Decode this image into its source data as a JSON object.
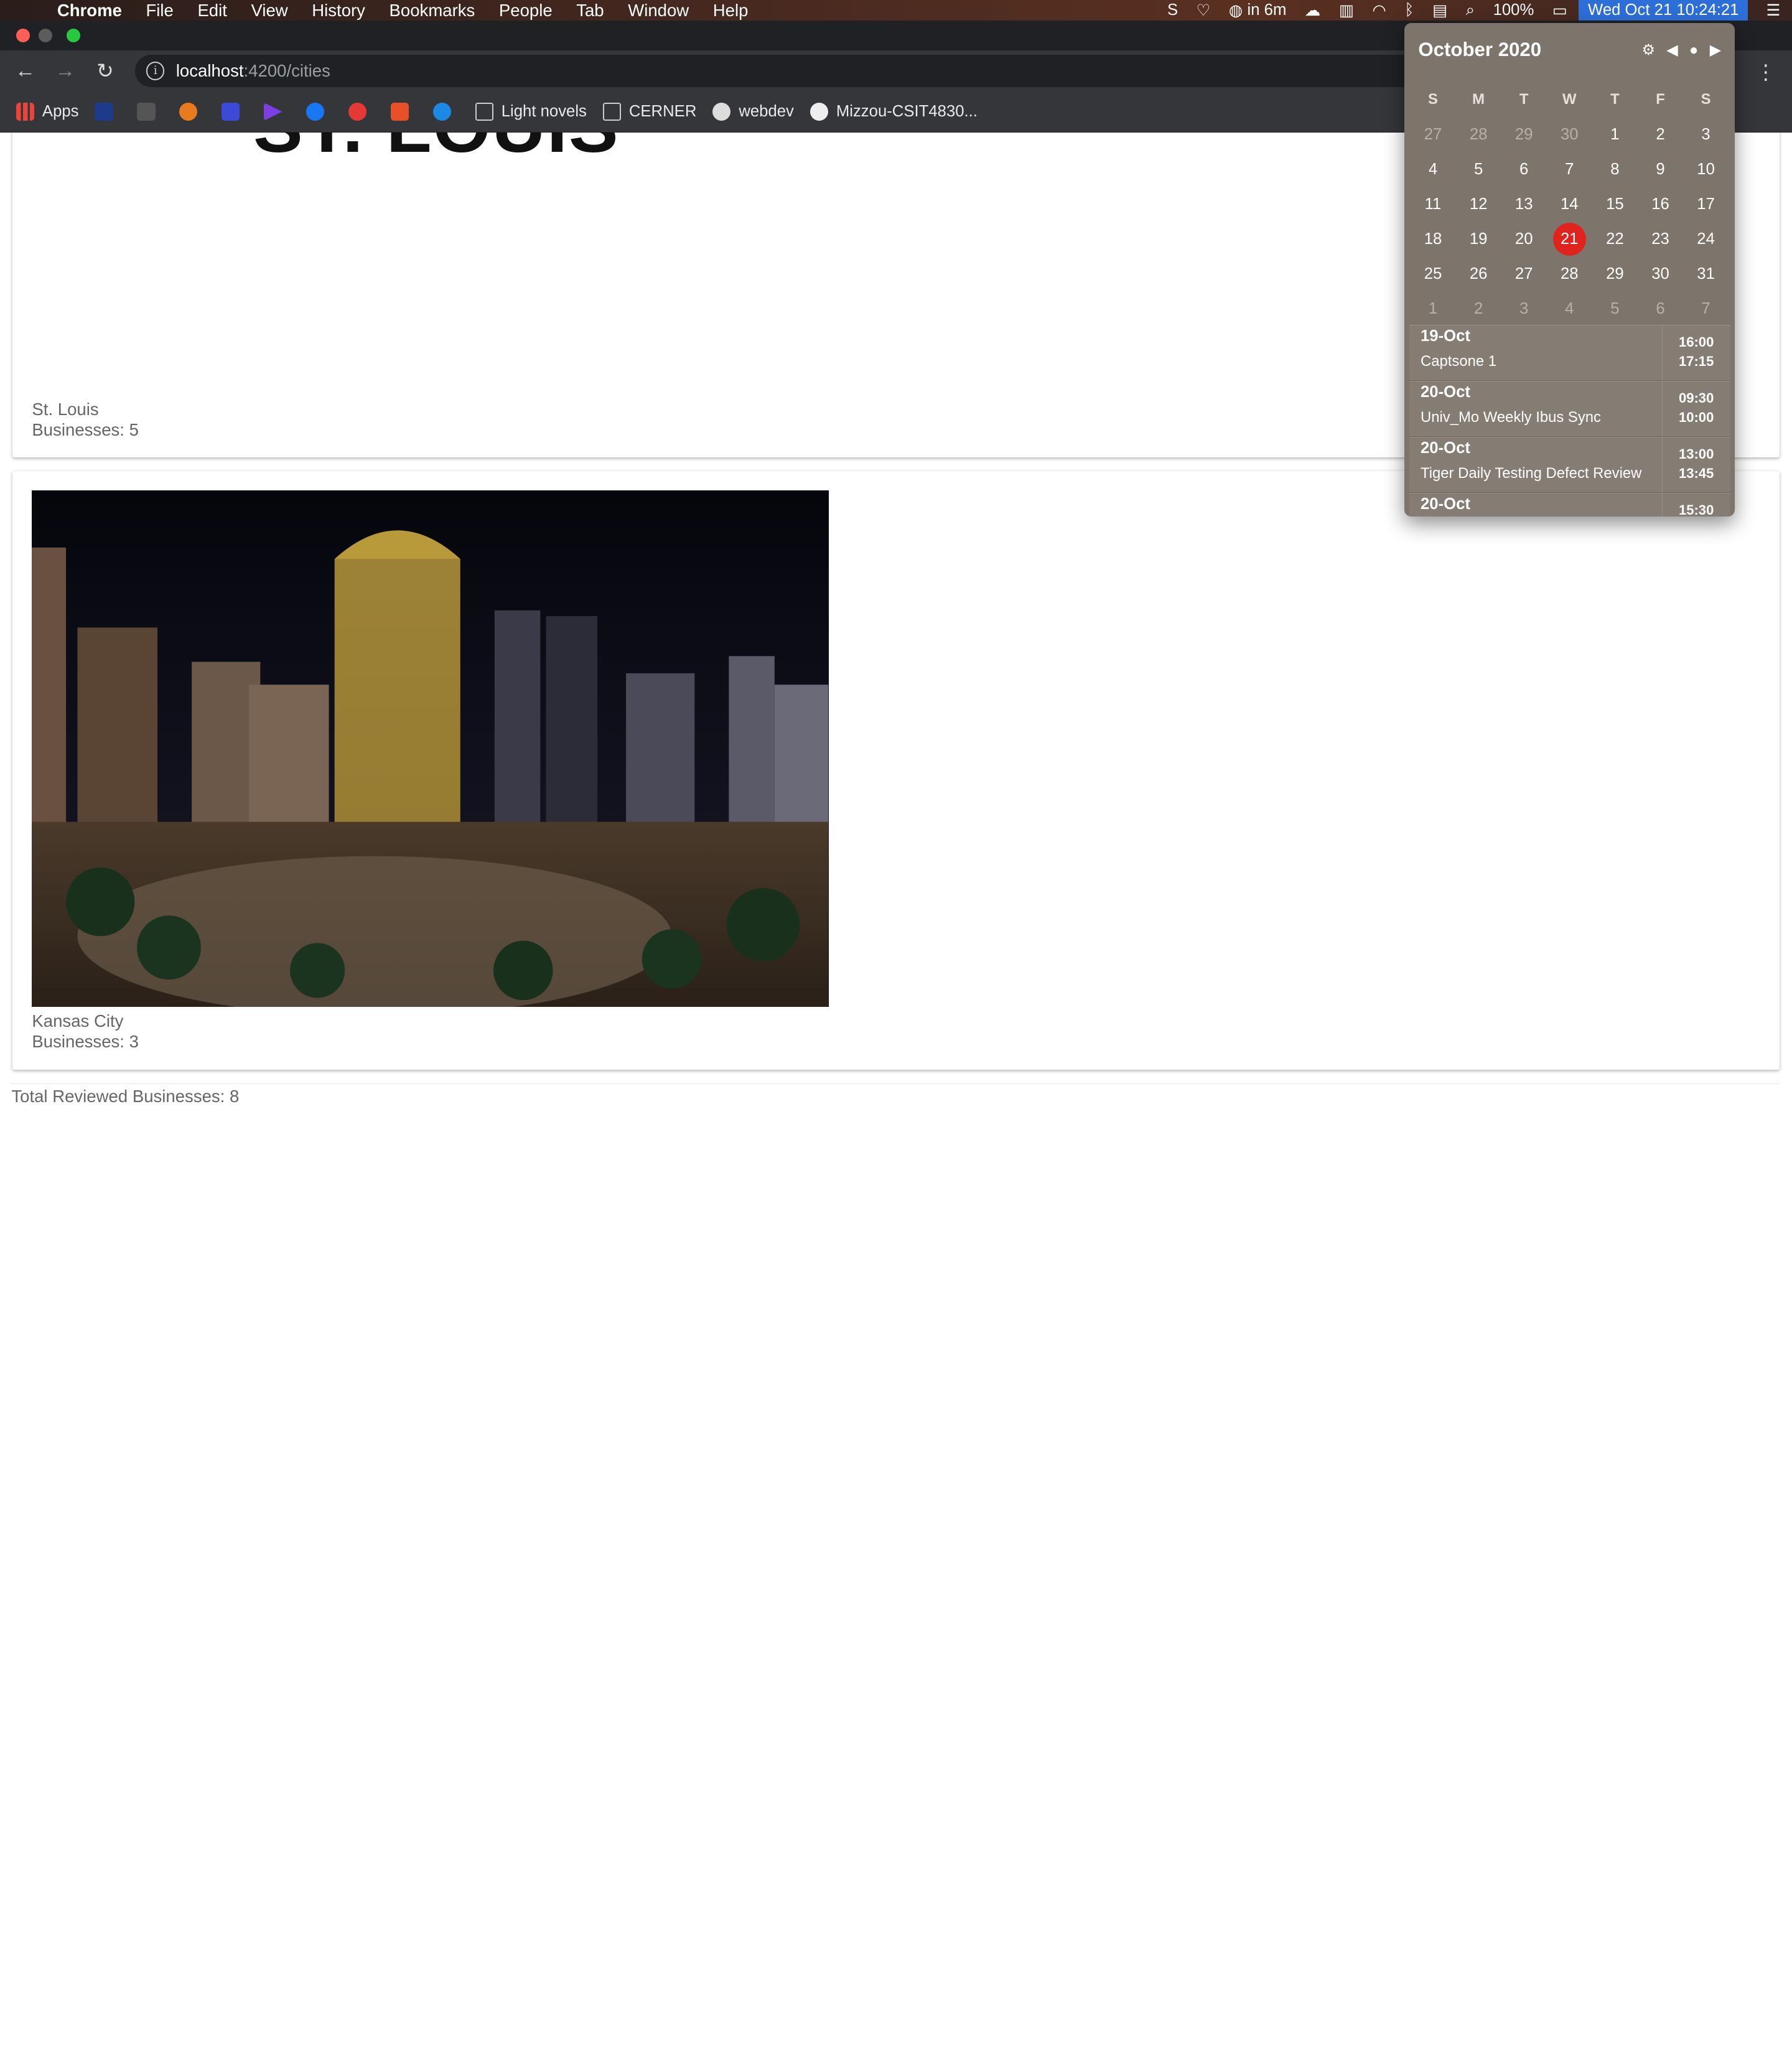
{
  "menubar": {
    "app": "Chrome",
    "items": [
      "File",
      "Edit",
      "View",
      "History",
      "Bookmarks",
      "People",
      "Tab",
      "Window",
      "Help"
    ],
    "status": {
      "meeting": "in 6m",
      "battery": "100%",
      "clock": "Wed Oct 21  10:24:21"
    }
  },
  "browser": {
    "url_host": "localhost",
    "url_path": ":4200/cities",
    "bookmarks": [
      "Apps",
      "Light novels",
      "CERNER",
      "webdev",
      "Mizzou-CSIT4830..."
    ]
  },
  "cities": [
    {
      "logo_text": "ST. LOUIS",
      "name": "St. Louis",
      "businesses": "Businesses: 5"
    },
    {
      "name": "Kansas City",
      "businesses": "Businesses: 3"
    }
  ],
  "total": "Total Reviewed Businesses: 8",
  "calendar": {
    "month": "October 2020",
    "weekdays": [
      "S",
      "M",
      "T",
      "W",
      "T",
      "F",
      "S"
    ],
    "weeks": [
      [
        "27",
        "28",
        "29",
        "30",
        "1",
        "2",
        "3"
      ],
      [
        "4",
        "5",
        "6",
        "7",
        "8",
        "9",
        "10"
      ],
      [
        "11",
        "12",
        "13",
        "14",
        "15",
        "16",
        "17"
      ],
      [
        "18",
        "19",
        "20",
        "21",
        "22",
        "23",
        "24"
      ],
      [
        "25",
        "26",
        "27",
        "28",
        "29",
        "30",
        "31"
      ],
      [
        "1",
        "2",
        "3",
        "4",
        "5",
        "6",
        "7"
      ]
    ],
    "today": "21",
    "events": [
      {
        "date": "19-Oct",
        "title": "Captsone 1",
        "start": "16:00",
        "end": "17:15"
      },
      {
        "date": "20-Oct",
        "title": "Univ_Mo Weekly Ibus Sync",
        "start": "09:30",
        "end": "10:00"
      },
      {
        "date": "20-Oct",
        "title": "Tiger Daily Testing Defect Review",
        "start": "13:00",
        "end": "13:45"
      },
      {
        "date": "20-Oct",
        "title": "",
        "start": "15:30",
        "end": ""
      }
    ]
  },
  "colors": {
    "today": "#e0241d",
    "clock_bg": "#2d6fd8",
    "chrome_bg": "#35363a"
  }
}
